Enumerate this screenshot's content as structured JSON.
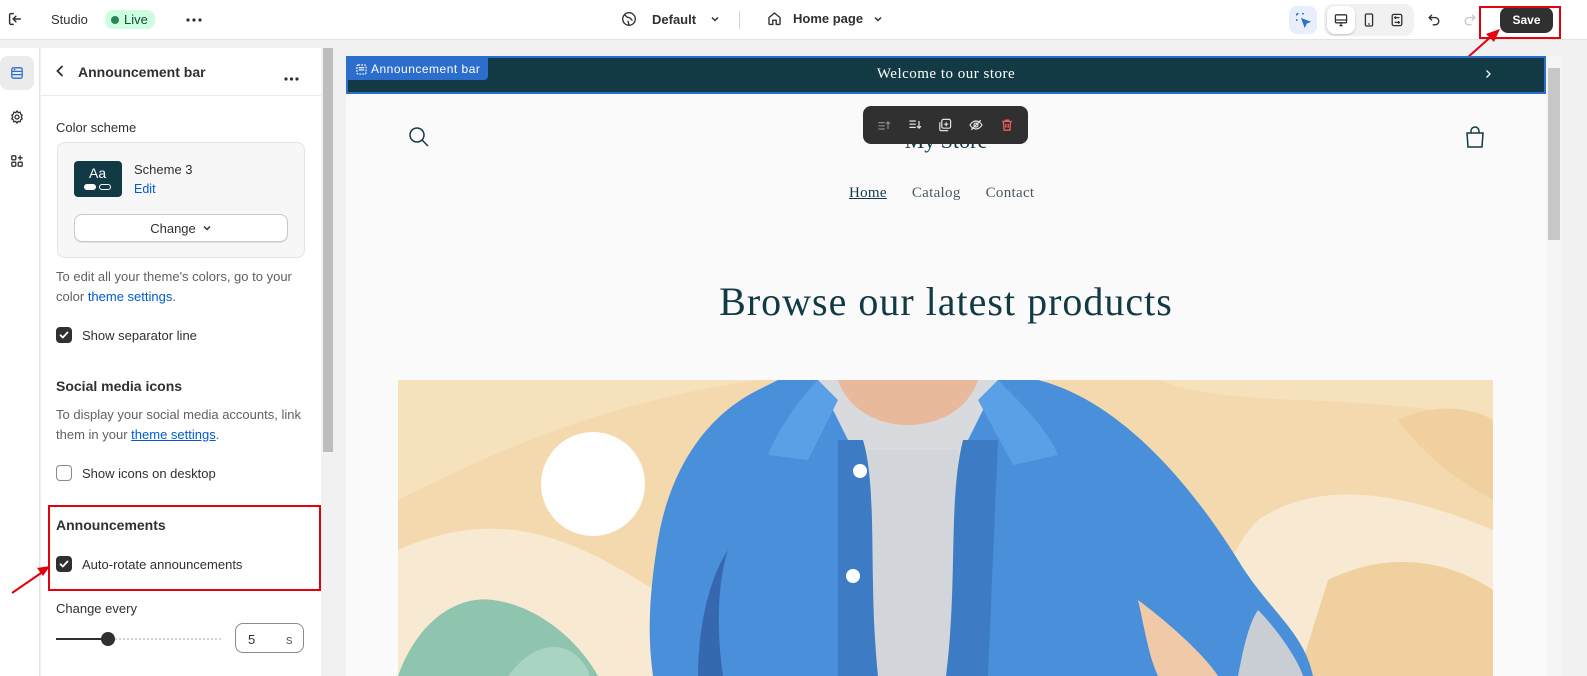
{
  "topbar": {
    "app_name": "Studio",
    "status_badge": "Live",
    "theme_selector": "Default",
    "page_selector": "Home page",
    "save_label": "Save"
  },
  "panel": {
    "title": "Announcement bar",
    "color_scheme_label": "Color scheme",
    "scheme_name": "Scheme 3",
    "scheme_preview_text": "Aa",
    "scheme_edit_link": "Edit",
    "change_button": "Change",
    "colors_help_prefix": "To edit all your theme's colors, go to your color",
    "colors_help_link": "theme settings",
    "colors_help_suffix": ".",
    "separator_label": "Show separator line",
    "separator_checked": true,
    "social_heading": "Social media icons",
    "social_help_prefix": "To display your social media accounts, link them in your",
    "social_help_link": "theme settings",
    "social_help_suffix": ".",
    "social_desktop_label": "Show icons on desktop",
    "social_desktop_checked": false,
    "announcements_heading": "Announcements",
    "autorotate_label": "Auto-rotate announcements",
    "autorotate_checked": true,
    "change_every_label": "Change every",
    "change_every_value": "5",
    "change_every_unit": "s",
    "slider_fraction": 0.3
  },
  "preview": {
    "section_tag": "Announcement bar",
    "announcement_text": "Welcome to our store",
    "store_name": "My Store",
    "nav": [
      "Home",
      "Catalog",
      "Contact"
    ],
    "hero_title": "Browse our latest products"
  },
  "colors": {
    "accent_blue": "#2c6ecb",
    "announcement_bg": "#123a45",
    "highlight_red": "#e3000f",
    "live_green": "#29845a"
  }
}
